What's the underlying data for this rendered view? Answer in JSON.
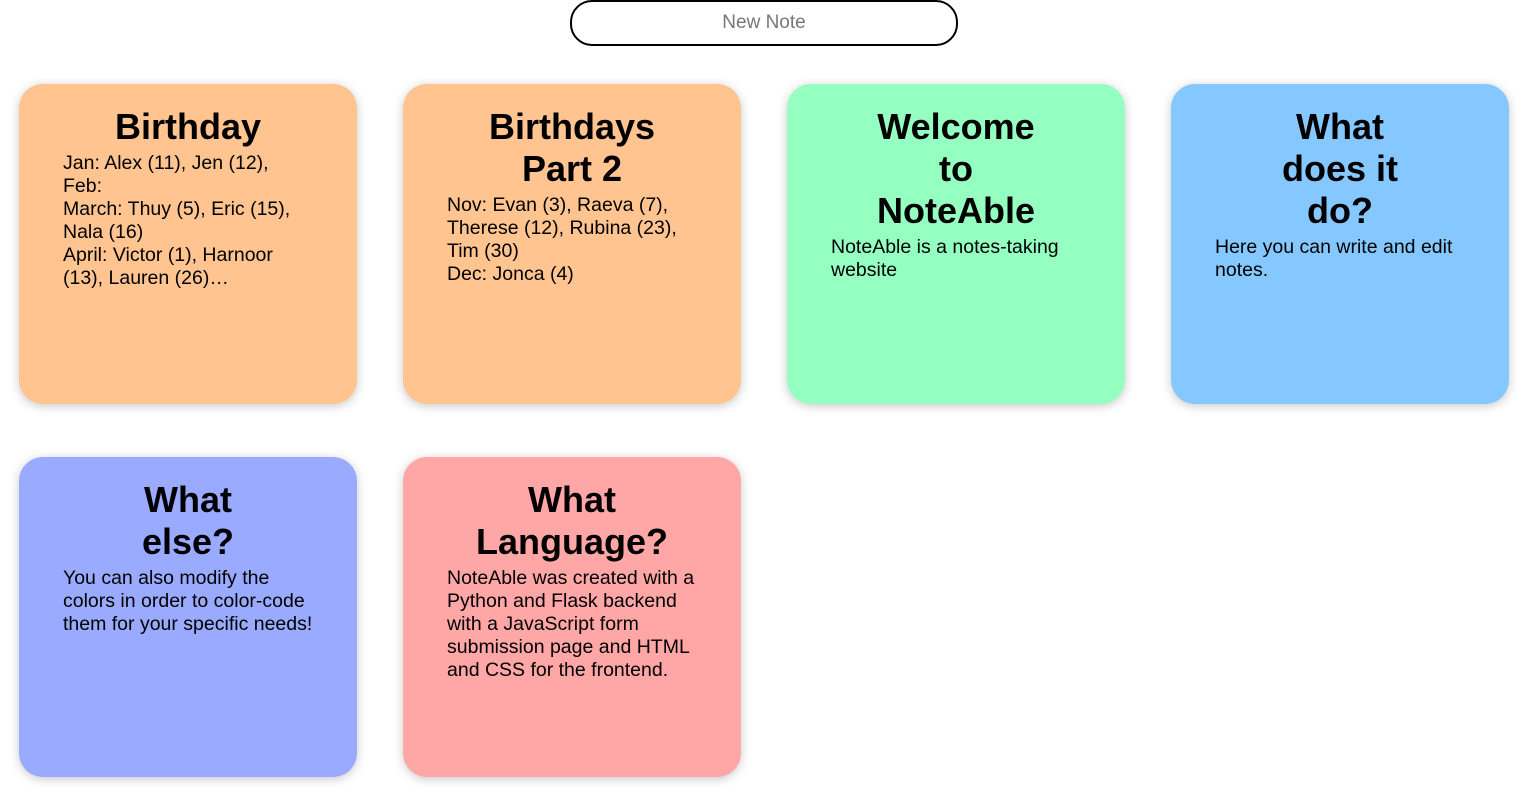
{
  "new_note": {
    "label": "New Note"
  },
  "notes": [
    {
      "title": "Birthday",
      "body": "Jan: Alex (11), Jen (12),\nFeb:\nMarch: Thuy (5), Eric (15),\nNala (16)\nApril: Victor (1), Harnoor\n(13), Lauren (26)…",
      "color": "#ffc48f"
    },
    {
      "title": "Birthdays Part 2",
      "body": "Nov: Evan (3), Raeva (7),\nTherese (12), Rubina (23),\nTim (30)\nDec: Jonca (4)",
      "color": "#ffc48f"
    },
    {
      "title": "Welcome to NoteAble",
      "body": "NoteAble is a notes-taking website",
      "color": "#94ffc0"
    },
    {
      "title": "What does it do?",
      "body": "Here you can write and edit notes.",
      "color": "#85c8ff"
    },
    {
      "title": "What else?",
      "body": "You can also modify the colors in order to color-code them for your specific needs!",
      "color": "#99aaff"
    },
    {
      "title": "What Language?",
      "body": "NoteAble was created with a Python and Flask backend with a JavaScript form submission page and HTML and CSS for the frontend.",
      "color": "#ffa6a6"
    }
  ]
}
